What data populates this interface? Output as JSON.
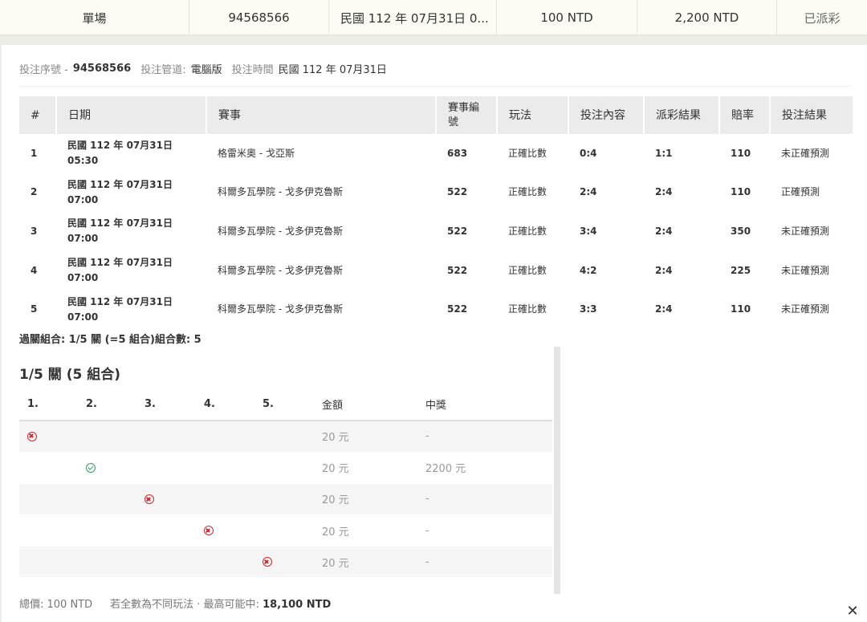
{
  "summary": {
    "type": "單場",
    "serial": "94568566",
    "time": "民國 112 年 07月31日 0...",
    "stake": "100 NTD",
    "payout": "2,200 NTD",
    "status": "已派彩"
  },
  "meta": {
    "serial_label": "投注序號 -",
    "serial_value": "94568566",
    "channel_label": "投注管道:",
    "channel_value": "電腦版",
    "time_label": "投注時間",
    "time_value": "民國 112 年 07月31日"
  },
  "matches": {
    "headers": [
      "#",
      "日期",
      "賽事",
      "賽事編號",
      "玩法",
      "投注內容",
      "派彩結果",
      "賠率",
      "投注結果"
    ],
    "rows": [
      {
        "no": "1",
        "date1": "民國 112 年 07月31日",
        "date2": "05:30",
        "event": "格雷米奧 - 戈亞斯",
        "code": "683",
        "play": "正確比數",
        "bet": "0:4",
        "result": "1:1",
        "odds": "110",
        "outcome": "未正確預測"
      },
      {
        "no": "2",
        "date1": "民國 112 年 07月31日",
        "date2": "07:00",
        "event": "科爾多瓦學院 - 戈多伊克魯斯",
        "code": "522",
        "play": "正確比數",
        "bet": "2:4",
        "result": "2:4",
        "odds": "110",
        "outcome": "正確預測"
      },
      {
        "no": "3",
        "date1": "民國 112 年 07月31日",
        "date2": "07:00",
        "event": "科爾多瓦學院 - 戈多伊克魯斯",
        "code": "522",
        "play": "正確比數",
        "bet": "3:4",
        "result": "2:4",
        "odds": "350",
        "outcome": "未正確預測"
      },
      {
        "no": "4",
        "date1": "民國 112 年 07月31日",
        "date2": "07:00",
        "event": "科爾多瓦學院 - 戈多伊克魯斯",
        "code": "522",
        "play": "正確比數",
        "bet": "4:2",
        "result": "2:4",
        "odds": "225",
        "outcome": "未正確預測"
      },
      {
        "no": "5",
        "date1": "民國 112 年 07月31日",
        "date2": "07:00",
        "event": "科爾多瓦學院 - 戈多伊克魯斯",
        "code": "522",
        "play": "正確比數",
        "bet": "3:3",
        "result": "2:4",
        "odds": "110",
        "outcome": "未正確預測"
      }
    ]
  },
  "combo": {
    "line": "過關組合: 1/5 關 (=5 組合)組合數: 5",
    "title": "1/5 關 (5 組合)",
    "headers": [
      "1.",
      "2.",
      "3.",
      "4.",
      "5.",
      "金額",
      "中獎"
    ],
    "rows": [
      {
        "amount": "20 元",
        "prize": "-"
      },
      {
        "amount": "20 元",
        "prize": "2200 元"
      },
      {
        "amount": "20 元",
        "prize": "-"
      },
      {
        "amount": "20 元",
        "prize": "-"
      },
      {
        "amount": "20 元",
        "prize": "-"
      }
    ]
  },
  "footer": {
    "total": "總價: 100 NTD",
    "note": "若全數為不同玩法 · 最高可能中:",
    "max": "18,100 NTD"
  },
  "close": "✕",
  "colors": {
    "lose": "#d0272e",
    "win": "#2e9e5c"
  },
  "icons": [
    "cross-circle-icon",
    "check-circle-icon",
    "close-icon"
  ]
}
